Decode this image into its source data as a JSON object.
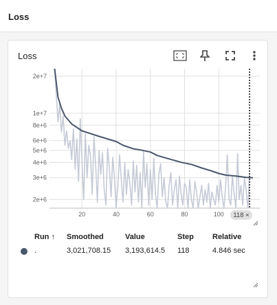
{
  "section": {
    "title": "Loss"
  },
  "card": {
    "title": "Loss",
    "toolbar": [
      {
        "name": "data-selection-icon"
      },
      {
        "name": "pin-icon"
      },
      {
        "name": "fullscreen-icon"
      },
      {
        "name": "more-vert-icon"
      }
    ]
  },
  "chart_data": {
    "type": "line",
    "title": "Loss",
    "xlabel": "",
    "ylabel": "",
    "log_scale_y": true,
    "xlim": [
      1,
      124
    ],
    "ylim": [
      1700000,
      23000000
    ],
    "x_ticks": [
      20,
      40,
      60,
      80,
      100
    ],
    "y_ticks": [
      {
        "value": 20000000,
        "label": "2e+7"
      },
      {
        "value": 10000000,
        "label": "1e+7"
      },
      {
        "value": 8000000,
        "label": "8e+6"
      },
      {
        "value": 6000000,
        "label": "6e+6"
      },
      {
        "value": 5000000,
        "label": "5e+6"
      },
      {
        "value": 4000000,
        "label": "4e+6"
      },
      {
        "value": 3000000,
        "label": "3e+6"
      },
      {
        "value": 2000000,
        "label": "2e+6"
      }
    ],
    "grid": true,
    "hover_step": 118,
    "series": [
      {
        "name": "Smoothed",
        "color": "#4a566b",
        "x": [
          4,
          6,
          8,
          10,
          14,
          20,
          30,
          40,
          44,
          50,
          54,
          60,
          64,
          70,
          78,
          84,
          90,
          96,
          100,
          104,
          110,
          116,
          120
        ],
        "y": [
          23000000,
          13500000,
          11000000,
          9500000,
          8200000,
          7200000,
          6500000,
          5900000,
          5500000,
          5150000,
          5050000,
          4850000,
          4550000,
          4300000,
          4000000,
          3850000,
          3600000,
          3400000,
          3250000,
          3150000,
          3100000,
          3021708,
          3000000
        ]
      },
      {
        "name": "Value",
        "color": "#c5cad6",
        "x": [
          4,
          6,
          7,
          8,
          9,
          10,
          11,
          12,
          13,
          14,
          15,
          16,
          17,
          18,
          19,
          20,
          21,
          22,
          23,
          24,
          25,
          26,
          27,
          28,
          29,
          30,
          31,
          32,
          33,
          34,
          35,
          36,
          37,
          38,
          39,
          40,
          41,
          42,
          43,
          44,
          45,
          46,
          47,
          48,
          49,
          50,
          51,
          52,
          53,
          54,
          55,
          56,
          57,
          58,
          59,
          60,
          61,
          62,
          63,
          64,
          65,
          66,
          67,
          68,
          69,
          70,
          71,
          72,
          73,
          74,
          75,
          76,
          77,
          78,
          79,
          80,
          81,
          82,
          83,
          84,
          85,
          86,
          87,
          88,
          89,
          90,
          91,
          92,
          93,
          94,
          95,
          96,
          97,
          98,
          99,
          100,
          101,
          102,
          103,
          104,
          105,
          106,
          107,
          108,
          109,
          110,
          111,
          112,
          113,
          114,
          115,
          116,
          117,
          118
        ],
        "y": [
          23000000,
          8500000,
          12000000,
          7000000,
          9500000,
          5500000,
          7200000,
          5200000,
          6000000,
          4200000,
          7500000,
          3500000,
          6200000,
          2800000,
          9000000,
          4000000,
          2000000,
          6800000,
          3000000,
          5500000,
          4500000,
          2200000,
          6500000,
          3800000,
          1900000,
          5000000,
          3200000,
          4800000,
          2400000,
          1800000,
          5200000,
          3600000,
          2100000,
          4400000,
          3000000,
          1700000,
          2600000,
          4600000,
          2900000,
          1900000,
          4000000,
          2200000,
          3500000,
          2700000,
          1800000,
          4100000,
          2300000,
          3800000,
          1900000,
          3300000,
          1700000,
          4900000,
          2500000,
          3900000,
          1800000,
          3500000,
          2000000,
          4300000,
          2200000,
          1700000,
          3200000,
          3900000,
          2100000,
          3000000,
          1900000,
          1700000,
          2600000,
          3300000,
          1800000,
          2400000,
          2900000,
          1700000,
          3100000,
          2200000,
          1800000,
          2700000,
          2500000,
          1700000,
          2900000,
          2000000,
          1700000,
          2800000,
          2300000,
          1700000,
          2100000,
          2600000,
          1800000,
          2400000,
          1900000,
          2700000,
          1700000,
          2300000,
          2000000,
          1800000,
          2600000,
          1900000,
          2900000,
          2100000,
          1700000,
          2500000,
          4600000,
          2000000,
          1800000,
          3100000,
          2200000,
          1700000,
          4700000,
          2000000,
          2600000,
          1800000,
          3000000,
          2400000,
          1700000,
          3193614
        ]
      }
    ]
  },
  "hover_badge": {
    "label": "118 ×"
  },
  "table": {
    "headers": {
      "run": "Run ↑",
      "smoothed": "Smoothed",
      "value": "Value",
      "step": "Step",
      "relative": "Relative"
    },
    "rows": [
      {
        "run": ".",
        "color": "#4a566b",
        "smoothed": "3,021,708.15",
        "value": "3,193,614.5",
        "step": "118",
        "relative": "4.846 sec"
      }
    ]
  }
}
